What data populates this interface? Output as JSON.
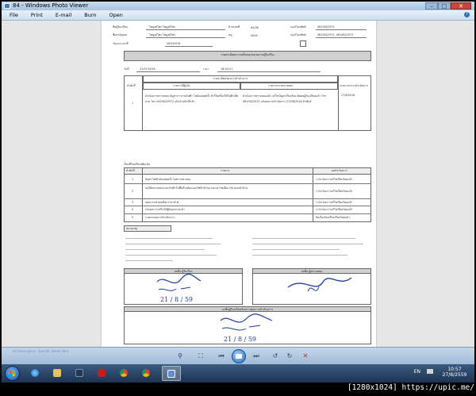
{
  "window": {
    "title": "84 - Windows Photo Viewer",
    "min_label": "–",
    "max_label": "□",
    "close_label": "✕"
  },
  "menu": {
    "items": [
      "File",
      "Print",
      "E-mail",
      "Burn",
      "Open"
    ],
    "help_label": "?"
  },
  "document": {
    "top_fields": [
      {
        "label": "ชื่อผู้ร้องเรียน",
        "value": "ไพบูลย์ไพร ไพบูลย์ไพร",
        "mid": "บ้านเลขที่",
        "mid_val": "64/36",
        "right": "เบอร์โทรศัพท์",
        "right_val": "0819022972"
      },
      {
        "label": "ชื่อสามัญชน",
        "value": "ไพบูลย์ไพร ไพบูลย์ไพร",
        "mid": "หมู่",
        "mid_val": "0004",
        "right": "เบอร์โทรศัพท์",
        "right_val": "0819022972, 0614822972"
      },
      {
        "label": "วันและเวลาที่",
        "value": "28/9/2016",
        "mid": "",
        "mid_val": "",
        "right": "",
        "right_val": ""
      }
    ],
    "section1_title": "รายละเอียดความเห็นของหน่วยงานผู้รับเรื่อง",
    "date_label": "วันที่",
    "date_value": "21/07/2016",
    "time_label": "เวลา",
    "time_value": "18:44:21",
    "table1_header": "รายละเอียดของการดำเนินการ",
    "table1_cols": [
      "ลำดับที่",
      "รายการที่ผู้แจ้ง",
      "รายการการตรวจสอบ",
      "ระยะเวลาการดำเนินการ"
    ],
    "table1_row": {
      "no": "1",
      "left": "ดำเนินการตรวจสอบ ปัญหาการจ่ายไฟฟ้า ไฟดับบ่อยครั้ง ทำให้เครื่องใช้ไฟฟ้าเสียหาย โทร 0819022972 แจ้งเจ้าหน้าที่แล้ว",
      "right": "ดำเนินการตรวจสอบแล้ว แก้ไขปัญหาเรียบร้อย ติดต่อผู้ร้องเรียนแล้ว โทร 0819022972 แจ้งผลการดำเนินการ 27/06/2016 ห้าพันส์",
      "date": "27/8/2016"
    },
    "section2_title": "เรื่องที่ร้องเรียนเพิ่มเติม",
    "table2_cols": [
      "ลำดับที่",
      "รายการ",
      "ผลดำเนินการ"
    ],
    "table2_rows": [
      {
        "no": "1",
        "text": "ปัญหาไฟฟ้าดับบ่อยครั้ง ไม่ทราบสาเหตุ",
        "result": "1 ดำเนินการแก้ไขเรียบร้อยแล้ว"
      },
      {
        "no": "2",
        "text": "ขอให้ตรวจสอบระบบไฟฟ้าในพื้นที่ หม้อแปลงไฟฟ้าชำรุด และเสาไฟเอียง บริเวณหน้าบ้าน",
        "result": "1 ดำเนินการแก้ไขเรียบร้อยแล้ว"
      },
      {
        "no": "3",
        "text": "ขอความช่วยเหลือการจ่ายไฟ",
        "result": "1 ดำเนินการแก้ไขเรียบร้อยแล้ว"
      },
      {
        "no": "4",
        "text": "แจ้งผลการแก้ไขให้ผู้ร้องทราบแล้ว",
        "result": "1 ดำเนินการแก้ไขเรียบร้อยแล้ว"
      },
      {
        "no": "5",
        "text": "รายงานผลการดำเนินการ",
        "result": "ปิดเรื่องร้องเรียนเรียบร้อยแล้ว"
      }
    ],
    "notes_title": "หมายเหตุ",
    "sig_left_title": "ลงชื่อ ผู้รับเรื่อง",
    "sig_right_title": "ลงชื่อ ผู้ตรวจสอบ",
    "final_title": "ลงชื่อผู้ร้องเรียนรับทราบผลการดำเนินการ",
    "sig_date": "21 / 8 / 59"
  },
  "controls": {
    "zoom": "⚲",
    "fit": "⛶",
    "prev": "⏮",
    "next": "⏭",
    "rotate_ccw": "↺",
    "rotate_cw": "↻",
    "delete": "✕",
    "ghost_text": "84 Description: Specific Detail Here"
  },
  "taskbar": {
    "lang": "EN",
    "time": "10:57",
    "date": "27/8/2559"
  },
  "watermark": "[1280x1024] https://upic.me/"
}
